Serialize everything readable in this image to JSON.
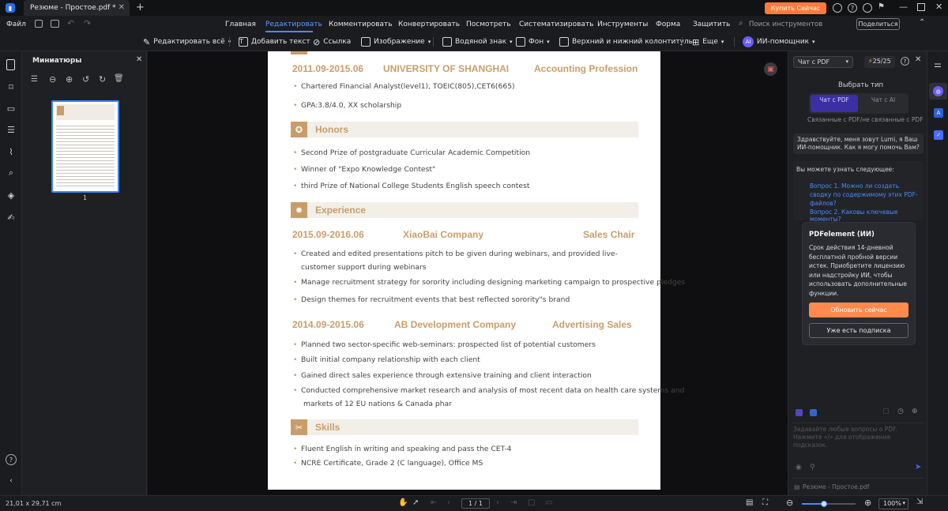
{
  "window": {
    "tab_title": "Резюме - Простое.pdf *",
    "buy_button": "Купить Сейчас"
  },
  "menu": {
    "file": "Файл",
    "items": [
      "Главная",
      "Редактировать",
      "Комментировать",
      "Конвертировать",
      "Посмотреть",
      "Систематизировать",
      "Инструменты",
      "Форма",
      "Защитить"
    ],
    "search_placeholder": "Поиск инструментов",
    "share": "Поделиться"
  },
  "toolbar": {
    "edit_all": "Редактировать всё",
    "add_text": "Добавить текст",
    "link": "Ссылка",
    "image": "Изображение",
    "watermark": "Водяной знак",
    "background": "Фон",
    "header_footer": "Верхний и нижний колонтитулы",
    "more": "Еще",
    "ai": "ИИ-помощник"
  },
  "thumbs": {
    "title": "Миниатюры",
    "page_number": "1"
  },
  "doc": {
    "edu_date": "2011.09-2015.06",
    "edu_school": "UNIVERSITY OF SHANGHAI",
    "edu_field": "Accounting Profession",
    "edu_items": [
      "Chartered Financial Analyst(level1), TOEIC(805),CET6(665)",
      "GPA:3.8/4.0, XX scholarship"
    ],
    "honors_title": "Honors",
    "honors_items": [
      "Second Prize of postgraduate Curricular Academic Competition",
      "Winner of \"Expo Knowledge Contest\"",
      "third Prize of National College Students English speech contest"
    ],
    "exp_title": "Experience",
    "job1_date": "2015.09-2016.06",
    "job1_company": "XiaoBai Company",
    "job1_role": "Sales Chair",
    "job1_items": [
      "Created and edited presentations pitch to be given during webinars, and provided live-",
      "customer support during webinars",
      "Manage recruitment strategy for sorority including designing marketing campaign to prospective pledges",
      "Design themes for recruitment events that best reflected sorority\"s brand"
    ],
    "job2_date": "2014.09-2015.06",
    "job2_company": "AB Development Company",
    "job2_role": "Advertising  Sales",
    "job2_items": [
      "Planned two sector-specific web-seminars: prospected list of potential customers",
      "Built initial company relationship with each client",
      "Gained direct sales experience through extensive training and client interaction",
      "Conducted comprehensive market research and analysis of most recent data on health care systems and",
      "markets of 12 EU nations & Canada phar"
    ],
    "skills_title": "Skills",
    "skills_items": [
      "Fluent English in writing and speaking and pass the CET-4",
      "NCRE Certificate, Grade 2 (C language), Office MS"
    ]
  },
  "ai": {
    "mode": "Чат с PDF",
    "credits": "25/25",
    "choose_type": "Выбрать тип",
    "type_pdf": "Чат с PDF",
    "type_ai": "Чат с AI",
    "type_desc": "Связанные с PDF/не связанные с PDF",
    "greeting": "Здравствуйте, меня зовут Lumi, я Ваш ИИ-помощник. Как я могу помочь Вам?",
    "learn": "Вы можете узнать следующее:",
    "q1": "Вопрос 1. Можно ли создать сводку по содержимому этих PDF-файлов?",
    "q2": "Вопрос 2. Каковы ключевые моменты?",
    "popup_title": "PDFelement (ИИ)",
    "popup_text": "Срок действия 14-дневной бесплатной пробной версии истек. Приобретите лицензию или надстройку ИИ, чтобы использовать дополнительные функции.",
    "popup_upgrade": "Обновить сейчас",
    "popup_have": "Уже есть подписка",
    "input_placeholder": "Задавайте любые вопросы о PDF. Нажмите «/» для отображения подсказок.",
    "file_name": "Резюме - Простое.pdf"
  },
  "status": {
    "size": "21,01 x 29,71 cm",
    "page": "1 / 1",
    "zoom": "100%"
  },
  "colors": {
    "accent": "#c99d6a",
    "brand_orange": "#ff7a3d",
    "active_blue": "#4a8bff"
  }
}
